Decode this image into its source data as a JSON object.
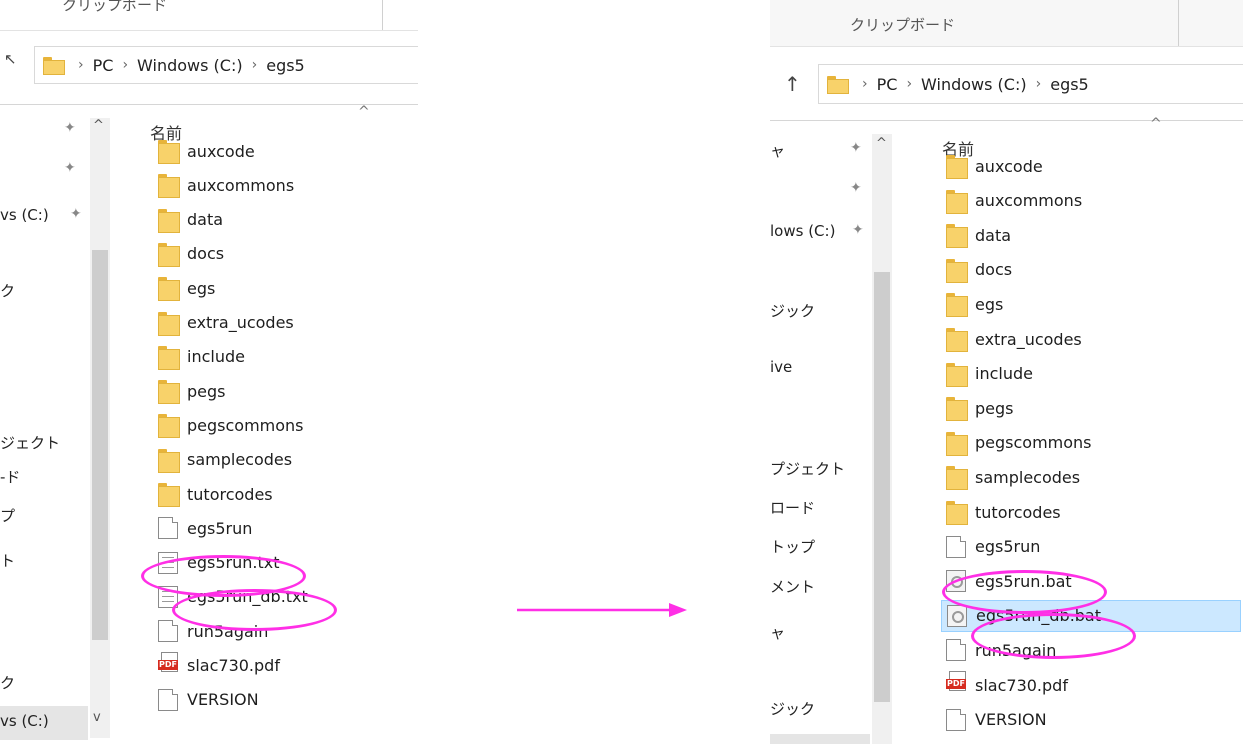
{
  "left_panel": {
    "ribbon_label": "クリップボード",
    "address": [
      "PC",
      "Windows (C:)",
      "egs5"
    ],
    "column_header": "名前",
    "nav_items": [
      "vs (C:)",
      "ク",
      "ジェクト",
      "-ド",
      "プ",
      "ト",
      "ク",
      "vs (C:)"
    ],
    "files": [
      {
        "name": "auxcode",
        "type": "folder"
      },
      {
        "name": "auxcommons",
        "type": "folder"
      },
      {
        "name": "data",
        "type": "folder"
      },
      {
        "name": "docs",
        "type": "folder"
      },
      {
        "name": "egs",
        "type": "folder"
      },
      {
        "name": "extra_ucodes",
        "type": "folder"
      },
      {
        "name": "include",
        "type": "folder"
      },
      {
        "name": "pegs",
        "type": "folder"
      },
      {
        "name": "pegscommons",
        "type": "folder"
      },
      {
        "name": "samplecodes",
        "type": "folder"
      },
      {
        "name": "tutorcodes",
        "type": "folder"
      },
      {
        "name": "egs5run",
        "type": "file"
      },
      {
        "name": "egs5run.txt",
        "type": "text"
      },
      {
        "name": "egs5run_db.txt",
        "type": "text"
      },
      {
        "name": "run5again",
        "type": "file"
      },
      {
        "name": "slac730.pdf",
        "type": "pdf"
      },
      {
        "name": "VERSION",
        "type": "file"
      }
    ]
  },
  "right_panel": {
    "ribbon_label": "クリップボード",
    "address": [
      "PC",
      "Windows (C:)",
      "egs5"
    ],
    "column_header": "名前",
    "nav_items": [
      "ャ",
      "lows (C:)",
      "ジック",
      "ive",
      "プジェクト",
      "ロード",
      "トップ",
      "メント",
      "ャ",
      "ジック"
    ],
    "files": [
      {
        "name": "auxcode",
        "type": "folder"
      },
      {
        "name": "auxcommons",
        "type": "folder"
      },
      {
        "name": "data",
        "type": "folder"
      },
      {
        "name": "docs",
        "type": "folder"
      },
      {
        "name": "egs",
        "type": "folder"
      },
      {
        "name": "extra_ucodes",
        "type": "folder"
      },
      {
        "name": "include",
        "type": "folder"
      },
      {
        "name": "pegs",
        "type": "folder"
      },
      {
        "name": "pegscommons",
        "type": "folder"
      },
      {
        "name": "samplecodes",
        "type": "folder"
      },
      {
        "name": "tutorcodes",
        "type": "folder"
      },
      {
        "name": "egs5run",
        "type": "file"
      },
      {
        "name": "egs5run.bat",
        "type": "bat"
      },
      {
        "name": "egs5run_db.bat",
        "type": "bat",
        "selected": true
      },
      {
        "name": "run5again",
        "type": "file"
      },
      {
        "name": "slac730.pdf",
        "type": "pdf"
      },
      {
        "name": "VERSION",
        "type": "file"
      }
    ]
  },
  "colors": {
    "highlight": "#ff2fe6",
    "selection": "#cce8ff",
    "folder": "#f8d26a"
  }
}
